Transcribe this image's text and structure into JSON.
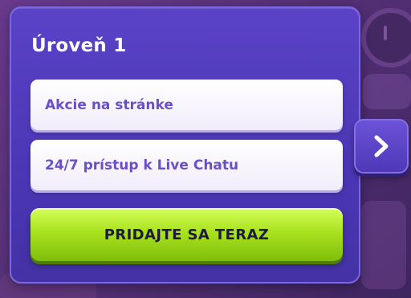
{
  "panel": {
    "title": "Úroveň 1",
    "features": [
      {
        "label": "Akcie na stránke"
      },
      {
        "label": "24/7 prístup k Live Chatu"
      }
    ],
    "cta_label": "PRIDAJTE SA TERAZ"
  },
  "navigation": {
    "next_icon": "chevron-right-icon"
  },
  "colors": {
    "panel": "#4b36b4",
    "feature_text": "#6a4fc8",
    "cta": "#a9e21f",
    "cta_text": "#1f1a3a"
  }
}
